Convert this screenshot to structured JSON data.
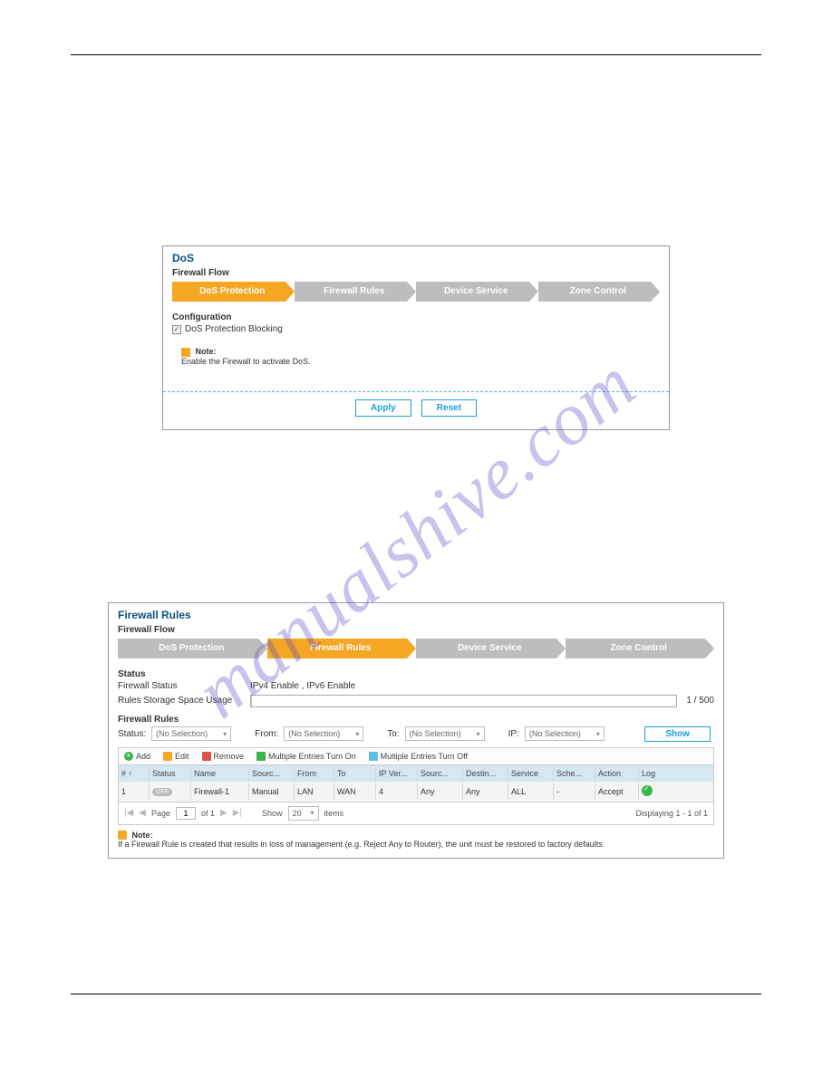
{
  "watermark": "manualshive.com",
  "dos": {
    "title": "DoS",
    "flow_label": "Firewall Flow",
    "flow": [
      "DoS Protection",
      "Firewall Rules",
      "Device Service",
      "Zone Control"
    ],
    "config_title": "Configuration",
    "checkbox_label": "DoS Protection Blocking",
    "note_label": "Note:",
    "note_text": "Enable the Firewall to activate DoS.",
    "apply": "Apply",
    "reset": "Reset"
  },
  "fw": {
    "title": "Firewall Rules",
    "flow_label": "Firewall Flow",
    "flow": [
      "DoS Protection",
      "Firewall Rules",
      "Device Service",
      "Zone Control"
    ],
    "status_title": "Status",
    "firewall_status_label": "Firewall Status",
    "firewall_status_value": "IPv4 Enable , IPv6 Enable",
    "usage_label": "Rules Storage Space Usage",
    "usage_text": "1 / 500",
    "rules_title": "Firewall Rules",
    "filters": {
      "status": "Status:",
      "from": "From:",
      "to": "To:",
      "ip": "IP:",
      "no_selection": "(No Selection)",
      "show": "Show"
    },
    "toolbar": {
      "add": "Add",
      "edit": "Edit",
      "remove": "Remove",
      "on": "Multiple Entries Turn On",
      "off": "Multiple Entries Turn Off"
    },
    "columns": [
      "# ↑",
      "Status",
      "Name",
      "Sourc...",
      "From",
      "To",
      "IP Ver...",
      "Sourc...",
      "Destin...",
      "Service",
      "Sche...",
      "Action",
      "Log"
    ],
    "row": {
      "num": "1",
      "status": "OFF",
      "name": "Firewall-1",
      "source": "Manual",
      "from": "LAN",
      "to": "WAN",
      "ipver": "4",
      "src": "Any",
      "dst": "Any",
      "service": "ALL",
      "sched": "-",
      "action": "Accept"
    },
    "pager": {
      "page_label": "Page",
      "page": "1",
      "of_label": "of 1",
      "show_label": "Show",
      "show_value": "20",
      "items_label": "items",
      "display": "Displaying 1 - 1 of 1"
    },
    "note_label": "Note:",
    "note_text": "If a Firewall Rule is created that results in loss of management (e.g. Reject Any to Router), the unit must be restored to factory defaults."
  }
}
